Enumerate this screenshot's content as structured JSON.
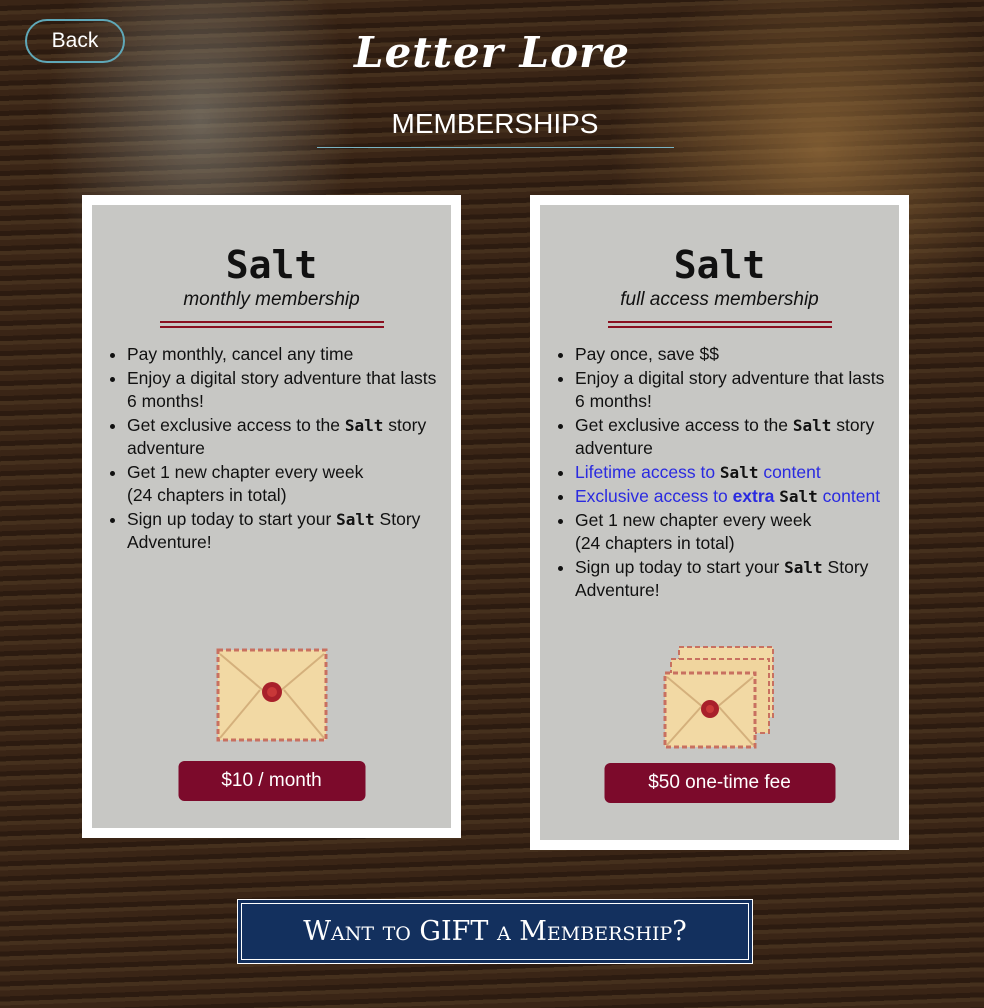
{
  "header": {
    "back_label": "Back",
    "logo": "Letter Lore",
    "subtitle": "MEMBERSHIPS"
  },
  "cards": [
    {
      "title": "Salt",
      "subtitle": "monthly membership",
      "price": "$10 / month",
      "image": "single-envelope-wax-seal",
      "items": [
        [
          {
            "t": "Pay monthly, cancel any time"
          }
        ],
        [
          {
            "t": "Enjoy a digital story adventure that lasts 6 months!"
          }
        ],
        [
          {
            "t": "Get exclusive access to the "
          },
          {
            "t": "Salt",
            "s": "mono"
          },
          {
            "t": " story adventure"
          }
        ],
        [
          {
            "t": "Get 1 new chapter every week"
          },
          {
            "br": true
          },
          {
            "t": "(24 chapters in total)"
          }
        ],
        [
          {
            "t": "Sign up today to start your "
          },
          {
            "t": "Salt",
            "s": "mono"
          },
          {
            "t": " Story Adventure!"
          }
        ]
      ]
    },
    {
      "title": "Salt",
      "subtitle": "full access membership",
      "price": "$50 one-time fee",
      "image": "stacked-envelopes-wax-seal",
      "items": [
        [
          {
            "t": "Pay once, save $$"
          }
        ],
        [
          {
            "t": "Enjoy a digital story adventure that lasts 6 months!"
          }
        ],
        [
          {
            "t": "Get exclusive access to the "
          },
          {
            "t": "Salt",
            "s": "mono"
          },
          {
            "t": " story adventure"
          }
        ],
        [
          {
            "t": "Lifetime access to ",
            "s": "blue"
          },
          {
            "t": "Salt",
            "s": "mono"
          },
          {
            "t": " content",
            "s": "blue"
          }
        ],
        [
          {
            "t": "Exclusive access to ",
            "s": "blue"
          },
          {
            "t": "extra",
            "s": "blue bold"
          },
          {
            "t": " "
          },
          {
            "t": "Salt",
            "s": "mono"
          },
          {
            "t": " content",
            "s": "blue"
          }
        ],
        [
          {
            "t": "Get 1 new chapter every week"
          },
          {
            "br": true
          },
          {
            "t": "(24 chapters in total)"
          }
        ],
        [
          {
            "t": "Sign up today to start your "
          },
          {
            "t": "Salt",
            "s": "mono"
          },
          {
            "t": " Story Adventure!"
          }
        ]
      ]
    }
  ],
  "gift_label": "Want to GIFT a Membership?",
  "colors": {
    "price_button": "#7c0a2b",
    "gift_button": "#13305e",
    "divider": "#8a1020",
    "back_border": "#5fa8b8"
  }
}
